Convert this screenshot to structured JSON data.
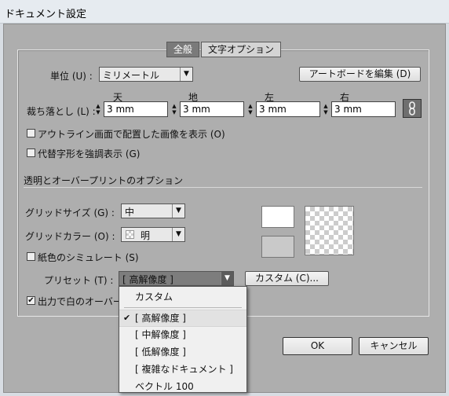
{
  "window": {
    "title": "ドキュメント設定"
  },
  "tabs": [
    {
      "label": "全般"
    },
    {
      "label": "文字オプション"
    }
  ],
  "units": {
    "label": "単位 (U) :",
    "value": "ミリメートル"
  },
  "edit_artboards_label": "アートボードを編集 (D)",
  "bleed": {
    "label": "裁ち落とし (L) :",
    "fields": [
      {
        "header": "天",
        "value": "3 mm"
      },
      {
        "header": "地",
        "value": "3 mm"
      },
      {
        "header": "左",
        "value": "3 mm"
      },
      {
        "header": "右",
        "value": "3 mm"
      }
    ]
  },
  "options": {
    "outline_label": "アウトライン画面で配置した画像を表示 (O)",
    "glyph_label": "代替字形を強調表示 (G)"
  },
  "transparency": {
    "section_title": "透明とオーバープリントのオプション",
    "grid_size_label": "グリッドサイズ (G) :",
    "grid_size_value": "中",
    "grid_color_label": "グリッドカラー (O) :",
    "grid_color_value": "明",
    "paper_label": "紙色のシミュレート (S)",
    "preset_label": "プリセット (T) :",
    "preset_value": "[ 高解像度 ]",
    "custom_button_label": "カスタム (C)...",
    "output_white_label": "出力で白のオーバー"
  },
  "dialog_buttons": {
    "ok": "OK",
    "cancel": "キャンセル"
  },
  "preset_menu": {
    "items": [
      {
        "label": "カスタム",
        "checked": false
      },
      {
        "label": "[ 高解像度 ]",
        "checked": true
      },
      {
        "label": "[ 中解像度 ]",
        "checked": false
      },
      {
        "label": "[ 低解像度 ]",
        "checked": false
      },
      {
        "label": "[ 複雑なドキュメント ]",
        "checked": false
      },
      {
        "label": "ベクトル 100",
        "checked": false
      }
    ]
  },
  "colors": {
    "window_bg": "#d8dde3",
    "panel_bg": "#aeaeae",
    "tab_active": "#7a7a7a"
  }
}
